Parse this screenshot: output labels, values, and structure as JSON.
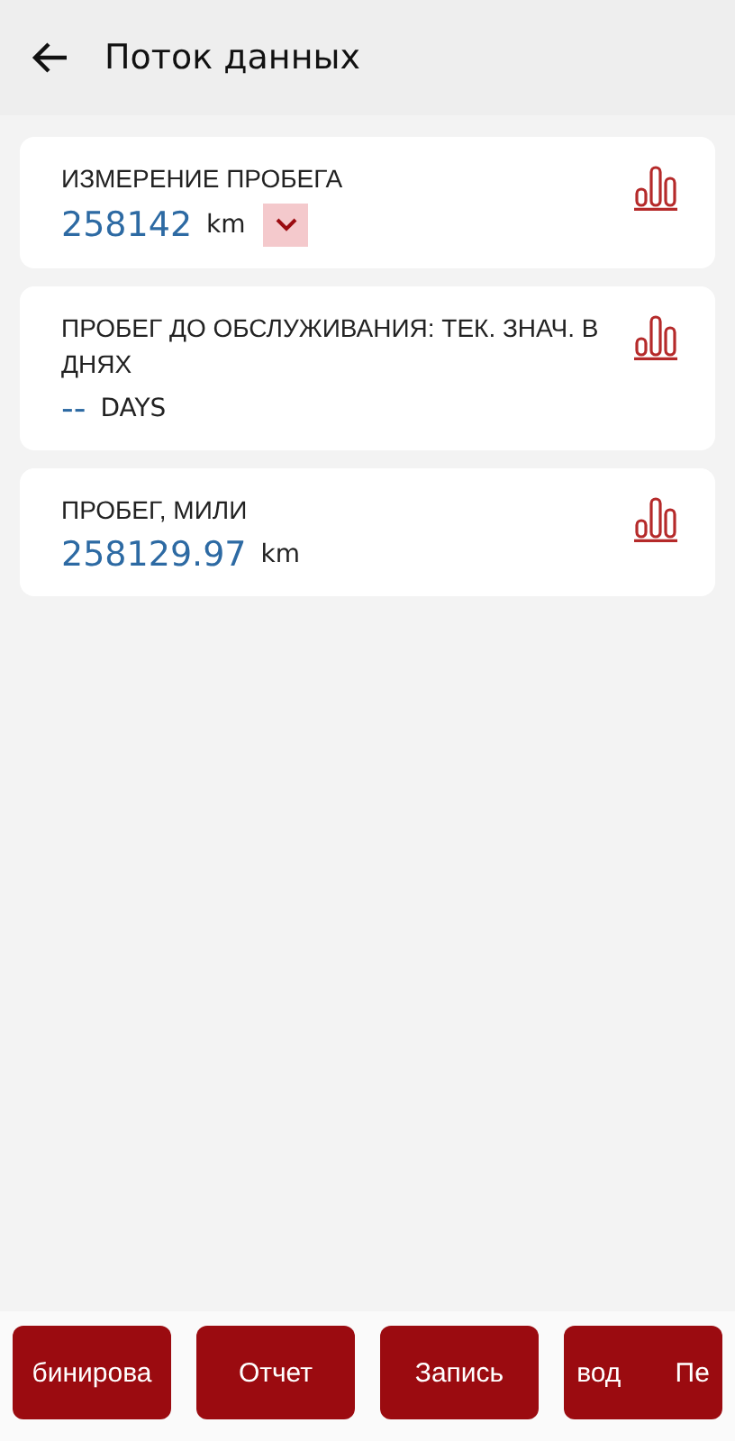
{
  "header": {
    "title": "Поток данных"
  },
  "items": [
    {
      "name": "ИЗМЕРЕНИЕ ПРОБЕГА",
      "value": "258142",
      "unit": "km",
      "dropdown": true
    },
    {
      "name": "ПРОБЕГ ДО ОБСЛУЖИВАНИЯ: ТЕК. ЗНАЧ. В ДНЯХ",
      "value": "--",
      "unit": "DAYS",
      "dropdown": false
    },
    {
      "name": "ПРОБЕГ, МИЛИ",
      "value": "258129.97",
      "unit": "km",
      "dropdown": false
    }
  ],
  "buttons": [
    {
      "label": "бинирова"
    },
    {
      "label": "Отчет"
    },
    {
      "label": "Запись"
    },
    {
      "label": "вод Пе"
    }
  ]
}
